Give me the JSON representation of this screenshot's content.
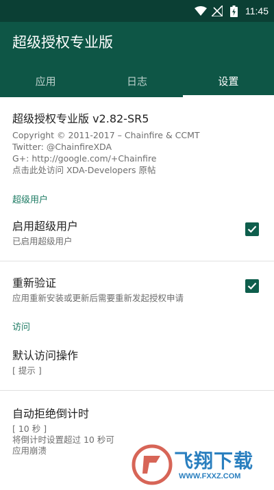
{
  "status_bar": {
    "time": "11:45"
  },
  "app": {
    "title": "超级授权专业版"
  },
  "tabs": [
    {
      "label": "应用",
      "active": false
    },
    {
      "label": "日志",
      "active": false
    },
    {
      "label": "设置",
      "active": true
    }
  ],
  "about": {
    "title": "超级授权专业版 v2.82-SR5",
    "copyright": "Copyright © 2011-2017 – Chainfire & CCMT",
    "twitter": "Twitter: @ChainfireXDA",
    "gplus": "G+: http://google.com/+Chainfire",
    "xda": "点击此处访问 XDA-Developers 原帖"
  },
  "sections": {
    "superuser": {
      "header": "超级用户",
      "enable": {
        "title": "启用超级用户",
        "summary": "已启用超级用户",
        "checked": true
      },
      "reauth": {
        "title": "重新验证",
        "summary": "应用重新安装或更新后需要重新发起授权申请",
        "checked": true
      }
    },
    "access": {
      "header": "访问",
      "default_action": {
        "title": "默认访问操作",
        "summary": "[ 提示 ]"
      },
      "auto_deny": {
        "title": "自动拒绝倒计时",
        "value": "[ 10 秒 ]",
        "summary_1": "将倒计时设置超过 10 秒可",
        "summary_2": "应用崩溃"
      }
    }
  },
  "watermark": {
    "text": "飞翔下载",
    "url": "WWW.FXXZ.COM"
  },
  "colors": {
    "status_bar": "#0b3f34",
    "app_bar": "#0e5646",
    "accent": "#1b7a62",
    "checkbox": "#0e5e4c"
  }
}
